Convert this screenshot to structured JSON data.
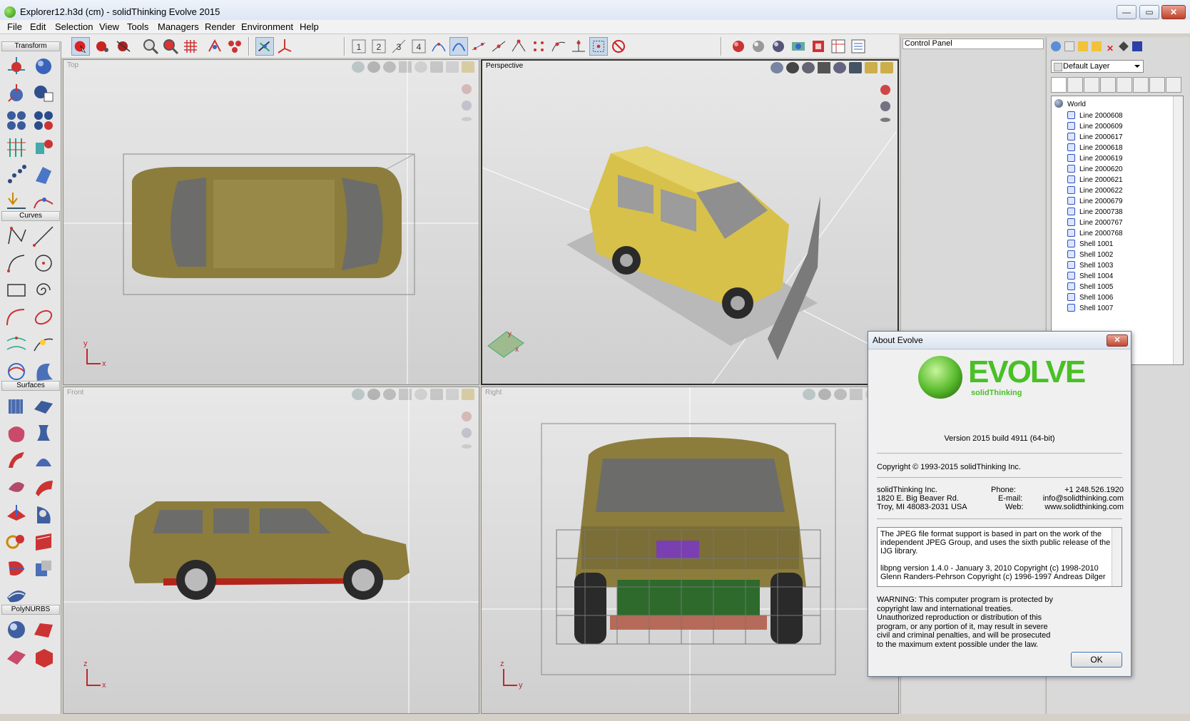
{
  "window": {
    "title": "Explorer12.h3d (cm) - solidThinking Evolve 2015",
    "minimize": "—",
    "maximize": "▭",
    "close": "✕"
  },
  "menu": [
    "File",
    "Edit",
    "Selection",
    "View",
    "Tools",
    "Managers",
    "Render",
    "Environment",
    "Help"
  ],
  "palette": {
    "sections": [
      "Transform",
      "Curves",
      "Surfaces",
      "PolyNURBS"
    ]
  },
  "viewports": {
    "top": {
      "label": "Top",
      "axis_v": "y",
      "axis_h": "x"
    },
    "perspective": {
      "label": "Perspective",
      "axis_v": "y",
      "axis_h": "x"
    },
    "front": {
      "label": "Front",
      "axis_v": "z",
      "axis_h": "x"
    },
    "right": {
      "label": "Right",
      "axis_v": "z",
      "axis_h": "y"
    }
  },
  "control_panel": {
    "title": "Control Panel"
  },
  "layers": {
    "selected_layer": "Default Layer",
    "root": "World",
    "items": [
      "Line 2000608",
      "Line 2000609",
      "Line 2000617",
      "Line 2000618",
      "Line 2000619",
      "Line 2000620",
      "Line 2000621",
      "Line 2000622",
      "Line 2000679",
      "Line 2000738",
      "Line 2000767",
      "Line 2000768",
      "Shell 1001",
      "Shell 1002",
      "Shell 1003",
      "Shell 1004",
      "Shell 1005",
      "Shell 1006",
      "Shell 1007"
    ]
  },
  "about": {
    "title": "About Evolve",
    "close": "✕",
    "logo_text": "EVOLVE",
    "logo_sub": "solidThinking",
    "version": "Version 2015 build 4911 (64-bit)",
    "copyright": "Copyright © 1993-2015 solidThinking Inc.",
    "company": "solidThinking Inc.",
    "address1": "1820 E. Big Beaver Rd.",
    "address2": "Troy, MI 48083-2031 USA",
    "phone_label": "Phone:",
    "phone": "+1 248.526.1920",
    "email_label": "E-mail:",
    "email": "info@solidthinking.com",
    "web_label": "Web:",
    "web": "www.solidthinking.com",
    "license_lines": [
      "The JPEG file format support is based in part on the work of the",
      "independent JPEG Group, and uses the sixth public release of the",
      "IJG library.",
      "",
      "libpng version 1.4.0 - January 3, 2010      Copyright (c) 1998-2010",
      "Glenn Randers-Pehrson     Copyright (c) 1996-1997 Andreas Dilger"
    ],
    "warning_lines": [
      "WARNING: This computer program is protected by",
      "copyright law and international treaties.",
      "Unauthorized reproduction or distribution of this",
      "program, or any portion of it, may result in severe",
      "civil and criminal penalties, and will be prosecuted",
      "to the maximum extent possible under the law."
    ],
    "ok": "OK"
  },
  "colors": {
    "car_body_flat": "#8c7d3c",
    "car_body_render": "#d7c14a",
    "logo_green": "#49c026",
    "axis_red": "#c0272d",
    "tree_icon_blue": "#2a4fc2"
  }
}
